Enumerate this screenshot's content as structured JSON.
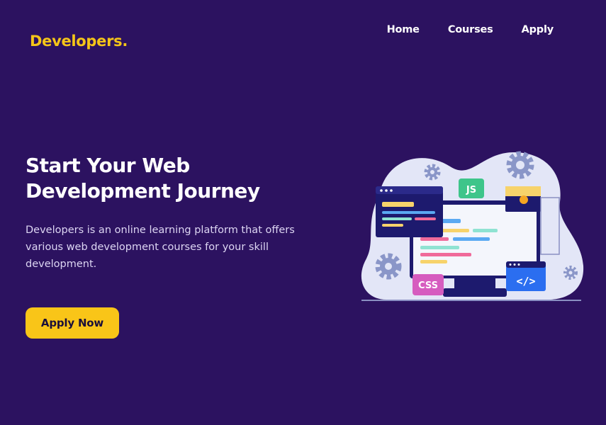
{
  "header": {
    "logo": "Developers.",
    "nav": [
      {
        "label": "Home"
      },
      {
        "label": "Courses"
      },
      {
        "label": "Apply"
      }
    ]
  },
  "hero": {
    "title": "Start Your Web Development Journey",
    "description": "Developers is an online learning platform that offers various web development courses for your skill development.",
    "cta": "Apply Now"
  },
  "illustration": {
    "badges": {
      "js": "JS",
      "css": "CSS",
      "code": "</>"
    }
  },
  "colors": {
    "background": "#2c1260",
    "accent": "#f9c518",
    "text": "#ffffff"
  }
}
